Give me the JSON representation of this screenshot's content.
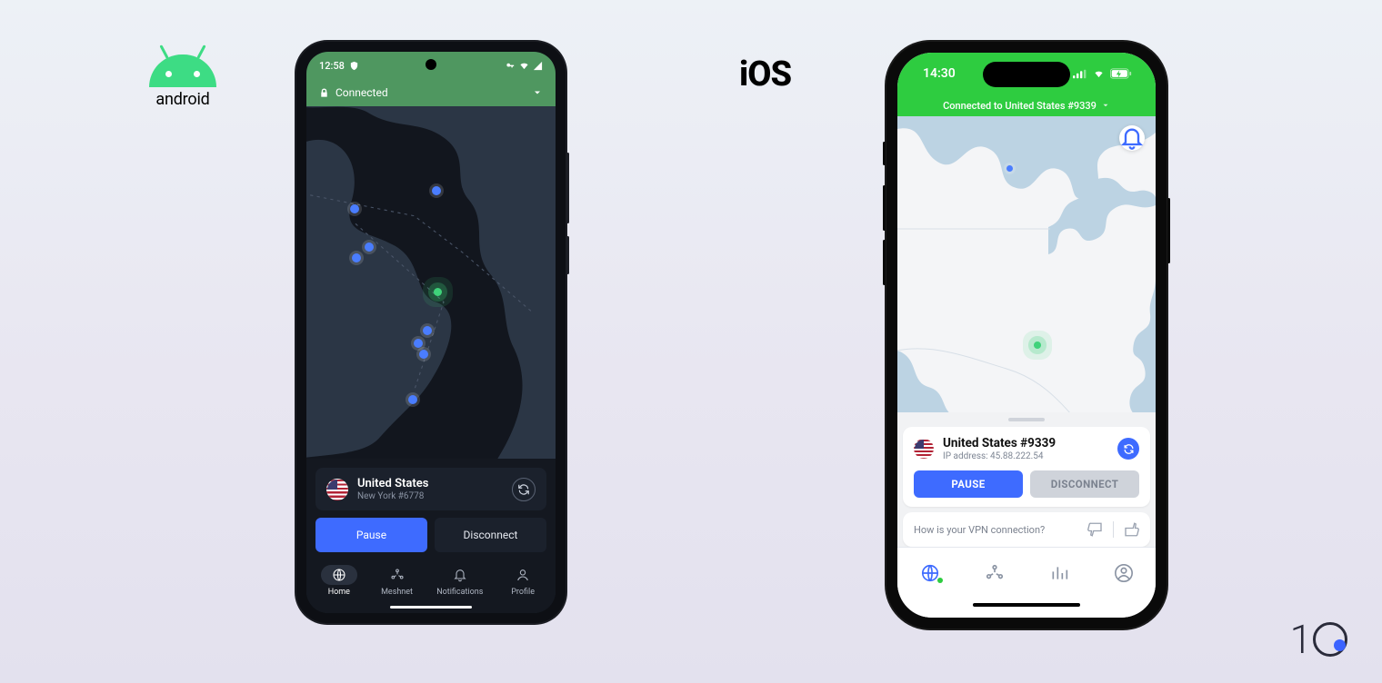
{
  "labels": {
    "android": "android",
    "ios": "iOS"
  },
  "android": {
    "status": {
      "time": "12:58"
    },
    "connected_label": "Connected",
    "server": {
      "country": "United States",
      "detail": "New York #6778"
    },
    "buttons": {
      "pause": "Pause",
      "disconnect": "Disconnect"
    },
    "nav": {
      "home": "Home",
      "meshnet": "Meshnet",
      "notifications": "Notifications",
      "profile": "Profile"
    }
  },
  "ios": {
    "status": {
      "time": "14:30"
    },
    "connected_label": "Connected to United States #9339",
    "server": {
      "title": "United States #9339",
      "ip_label": "IP address: 45.88.222.54"
    },
    "buttons": {
      "pause": "PAUSE",
      "disconnect": "DISCONNECT"
    },
    "feedback_q": "How is your VPN connection?"
  },
  "brand": {
    "ten": "1"
  }
}
